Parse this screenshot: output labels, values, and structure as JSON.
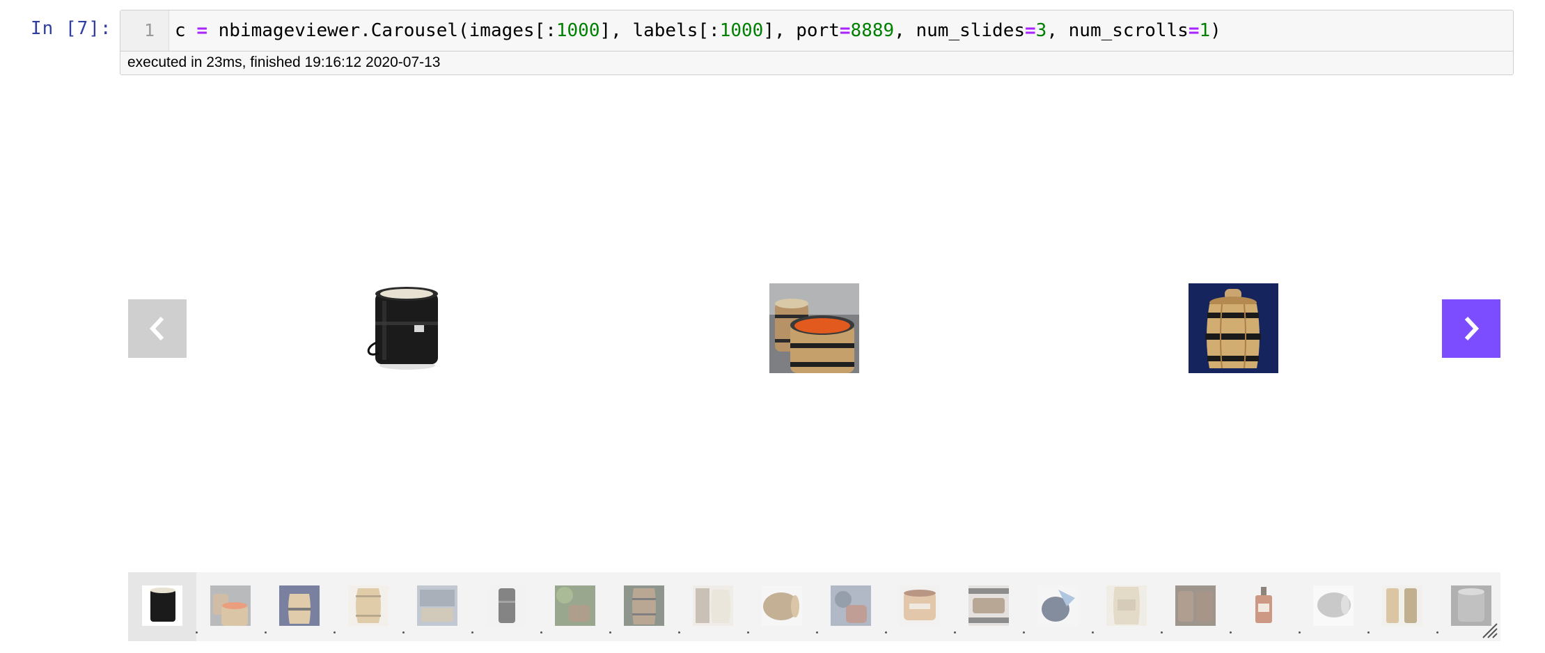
{
  "cell": {
    "prompt": "In [7]:",
    "line_number": "1",
    "code_parts": [
      {
        "t": "c ",
        "k": "plain"
      },
      {
        "t": "=",
        "k": "op"
      },
      {
        "t": " nbimageviewer.Carousel(images[:",
        "k": "plain"
      },
      {
        "t": "1000",
        "k": "num"
      },
      {
        "t": "], labels[:",
        "k": "plain"
      },
      {
        "t": "1000",
        "k": "num"
      },
      {
        "t": "], port",
        "k": "plain"
      },
      {
        "t": "=",
        "k": "op"
      },
      {
        "t": "8889",
        "k": "num"
      },
      {
        "t": ", num_slides",
        "k": "plain"
      },
      {
        "t": "=",
        "k": "op"
      },
      {
        "t": "3",
        "k": "num"
      },
      {
        "t": ", num_scrolls",
        "k": "plain"
      },
      {
        "t": "=",
        "k": "op"
      },
      {
        "t": "1",
        "k": "num"
      },
      {
        "t": ")",
        "k": "plain"
      }
    ],
    "timing": "executed in 23ms, finished 19:16:12 2020-07-13"
  },
  "carousel": {
    "prev_icon": "chevron-left-icon",
    "next_icon": "chevron-right-icon",
    "colors": {
      "prev_bg": "#cfcfcf",
      "next_bg": "#7b4dff"
    },
    "slides": [
      {
        "name": "slide-image-black-drum",
        "icon": "black-drum-image"
      },
      {
        "name": "slide-image-barrels-orange",
        "icon": "wooden-barrels-image"
      },
      {
        "name": "slide-image-small-barrel",
        "icon": "small-barrel-image"
      }
    ],
    "thumbnail_count": 20,
    "active_thumbnail": 1
  }
}
